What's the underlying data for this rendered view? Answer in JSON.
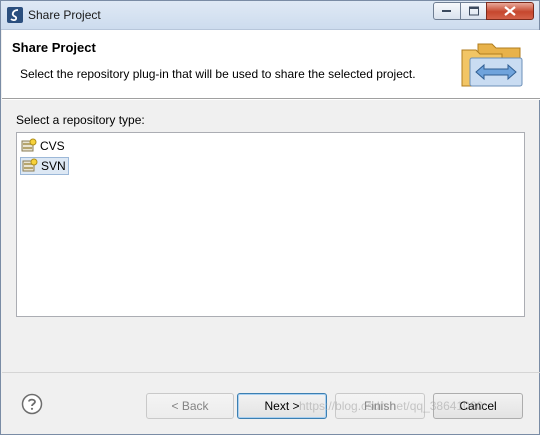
{
  "window": {
    "title": "Share Project"
  },
  "banner": {
    "title": "Share Project",
    "description": "Select the repository plug-in that will be used to share the selected project."
  },
  "main": {
    "section_label": "Select a repository type:",
    "repositories": [
      {
        "label": "CVS",
        "selected": false
      },
      {
        "label": "SVN",
        "selected": true
      }
    ]
  },
  "buttons": {
    "back": "< Back",
    "next": "Next >",
    "finish": "Finish",
    "cancel": "Cancel"
  },
  "icons": {
    "help": "help-icon",
    "banner": "share-project-icon",
    "repo": "repository-icon"
  },
  "watermark": "https://blog.csdn.net/qq_38641060"
}
